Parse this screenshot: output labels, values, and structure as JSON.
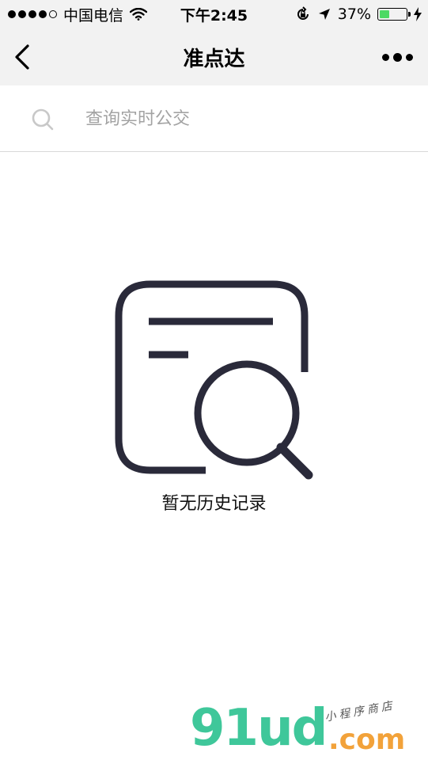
{
  "status_bar": {
    "carrier": "中国电信",
    "time": "下午2:45",
    "battery_percent": "37%",
    "battery_level": 0.37,
    "battery_color": "#4cd964"
  },
  "nav": {
    "title": "准点达",
    "back_icon": "chevron-left-icon",
    "more_icon": "more-dots-icon"
  },
  "search": {
    "placeholder": "查询实时公交",
    "value": ""
  },
  "empty_state": {
    "icon": "document-search-icon",
    "message": "暂无历史记录",
    "icon_color": "#2a2a3a"
  },
  "watermark": {
    "logo": "91ud",
    "domain": ".com",
    "tag": "小程序商店"
  }
}
